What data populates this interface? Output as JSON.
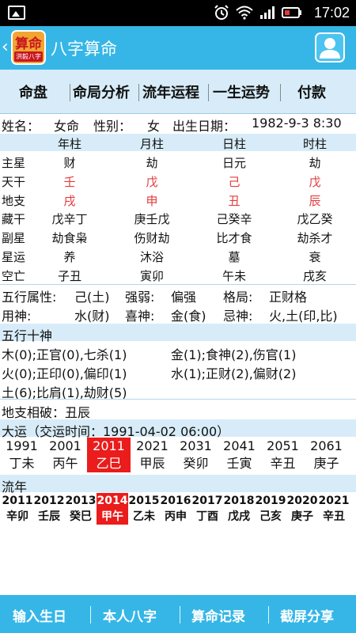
{
  "status_bar": {
    "time": "17:02"
  },
  "app_bar": {
    "back_glyph": "‹",
    "logo_text_top": "算命",
    "logo_text_bottom": "洪毅八字",
    "title": "八字算命"
  },
  "tabs": [
    "命盘",
    "命局分析",
    "流年运程",
    "一生运势",
    "付款"
  ],
  "basic_info": {
    "name_label": "姓名：",
    "name_value": "女命",
    "gender_label": "性别：",
    "gender_value": "女",
    "birth_label": "出生日期：",
    "birth_value": "1982-9-3 8:30"
  },
  "pillars": {
    "headers": [
      "年柱",
      "月柱",
      "日柱",
      "时柱"
    ],
    "rows": [
      {
        "label": "主星",
        "values": [
          "财",
          "劫",
          "日元",
          "劫"
        ],
        "red": false
      },
      {
        "label": "天干",
        "values": [
          "壬",
          "戊",
          "己",
          "戊"
        ],
        "red": true
      },
      {
        "label": "地支",
        "values": [
          "戌",
          "申",
          "丑",
          "辰"
        ],
        "red": true
      },
      {
        "label": "藏干",
        "values": [
          "戊辛丁",
          "庚壬戊",
          "己癸辛",
          "戊乙癸"
        ],
        "red": false
      },
      {
        "label": "副星",
        "values": [
          "劫食枭",
          "伤财劫",
          "比才食",
          "劫杀才"
        ],
        "red": false
      },
      {
        "label": "星运",
        "values": [
          "养",
          "沐浴",
          "墓",
          "衰"
        ],
        "red": false
      },
      {
        "label": "空亡",
        "values": [
          "子丑",
          "寅卯",
          "午未",
          "戌亥"
        ],
        "red": false
      }
    ]
  },
  "attributes": {
    "wuxing_label": "五行属性:",
    "wuxing_value": "己(土)",
    "strength_label": "强弱:",
    "strength_value": "偏强",
    "geju_label": "格局:",
    "geju_value": "正财格",
    "yongshen_label": "用神:",
    "yongshen_value": "水(财)",
    "xishen_label": "喜神:",
    "xishen_value": "金(食)",
    "jishen_label": "忌神:",
    "jishen_value": "火,土(印,比)"
  },
  "wuxing_shishen": {
    "title": "五行十神",
    "left": [
      "木(0);正官(0),七杀(1)",
      "火(0);正印(0),偏印(1)",
      "土(6);比肩(1),劫财(5)"
    ],
    "right": [
      "金(1);食神(2),伤官(1)",
      "水(1);正财(2),偏财(2)"
    ]
  },
  "dizhi": {
    "text": "地支相破：丑辰"
  },
  "dayun": {
    "title": "大运（交运时间：1991-04-02 06:00）",
    "years": [
      "1991",
      "2001",
      "2011",
      "2021",
      "2031",
      "2041",
      "2051",
      "2061"
    ],
    "ganzhi": [
      "丁未",
      "丙午",
      "乙巳",
      "甲辰",
      "癸卯",
      "壬寅",
      "辛丑",
      "庚子"
    ],
    "selected_index": 2,
    "selected_color": "#ea1c1c"
  },
  "liunian": {
    "title": "流年",
    "years": [
      "2011",
      "2012",
      "2013",
      "2014",
      "2015",
      "2016",
      "2017",
      "2018",
      "2019",
      "2020",
      "2021"
    ],
    "ganzhi": [
      "辛卯",
      "壬辰",
      "癸巳",
      "甲午",
      "乙未",
      "丙申",
      "丁酉",
      "戊戌",
      "己亥",
      "庚子",
      "辛丑"
    ],
    "selected_index": 3
  },
  "bottom_nav": [
    "输入生日",
    "本人八字",
    "算命记录",
    "截屏分享"
  ],
  "colors": {
    "accent": "#35b6e6",
    "band": "#d7ecf8",
    "highlight": "#ea1c1c",
    "red_text": "#e33b3b"
  }
}
